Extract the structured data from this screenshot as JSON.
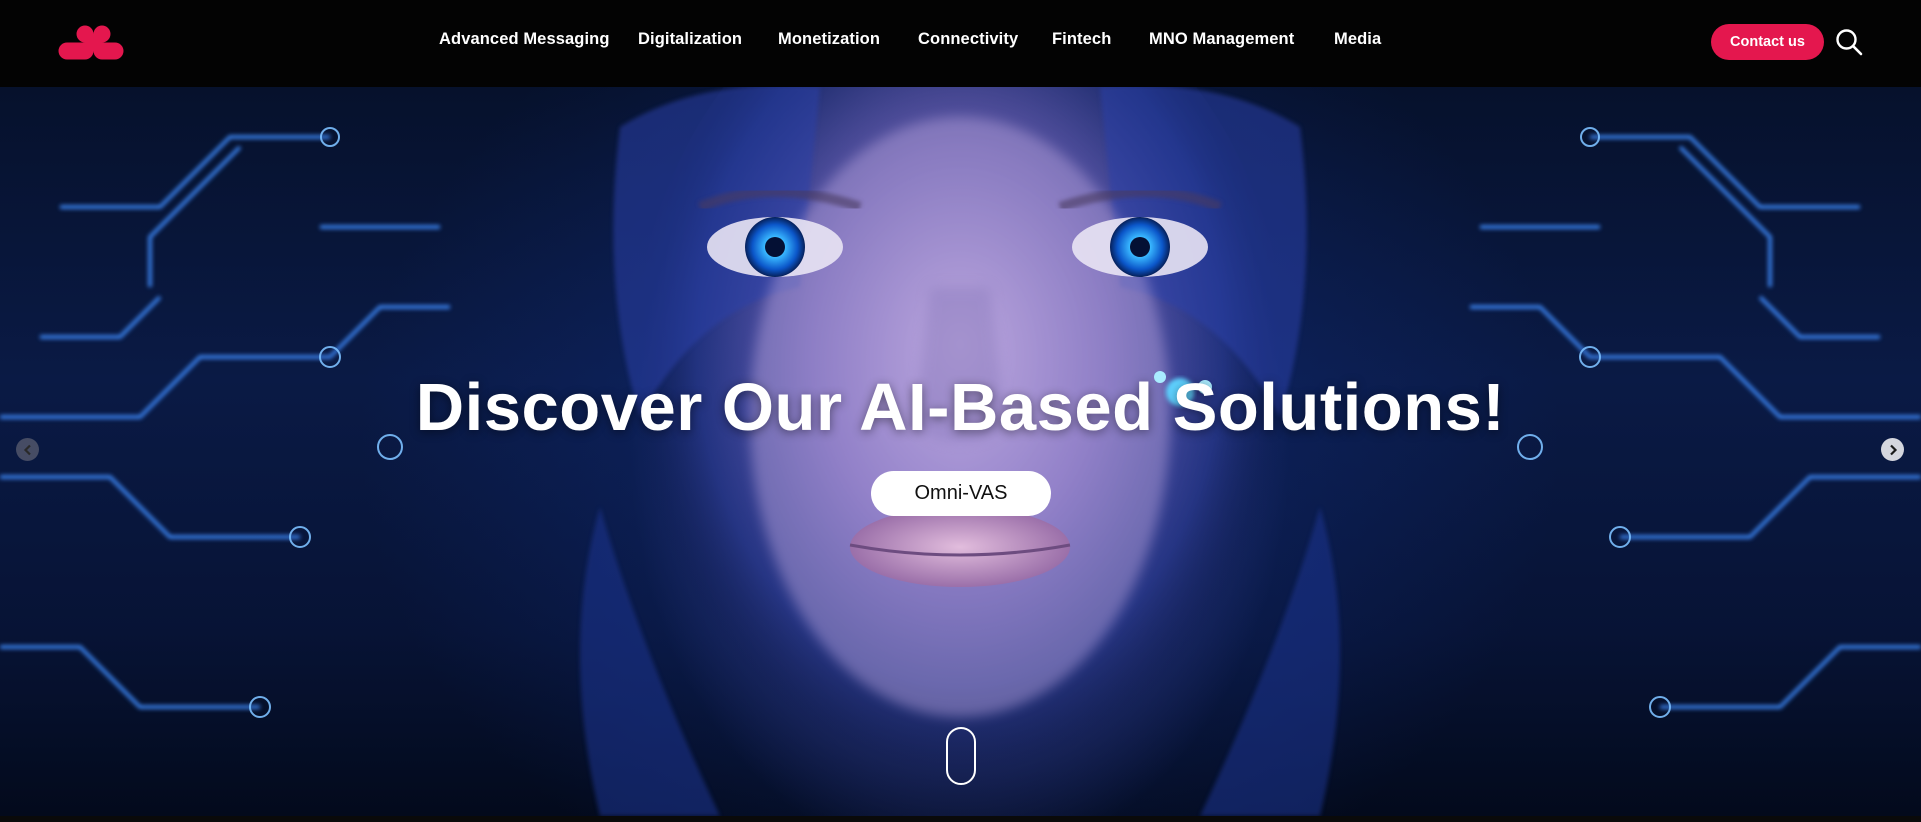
{
  "header": {
    "logo_icon": "brand-logo-icon",
    "brand_color": "#e4174e",
    "nav": [
      {
        "label": "Advanced Messaging"
      },
      {
        "label": "Digitalization"
      },
      {
        "label": "Monetization"
      },
      {
        "label": "Connectivity"
      },
      {
        "label": "Fintech"
      },
      {
        "label": "MNO Management"
      },
      {
        "label": "Media"
      }
    ],
    "contact_label": "Contact us",
    "search_icon": "search-icon"
  },
  "hero": {
    "title": "Discover Our AI-Based Solutions!",
    "cta_label": "Omni-VAS",
    "prev_icon": "chevron-left-icon",
    "next_icon": "chevron-right-icon",
    "scroll_icon": "mouse-scroll-icon",
    "background_image": "ai-cyborg-face-illustration"
  }
}
